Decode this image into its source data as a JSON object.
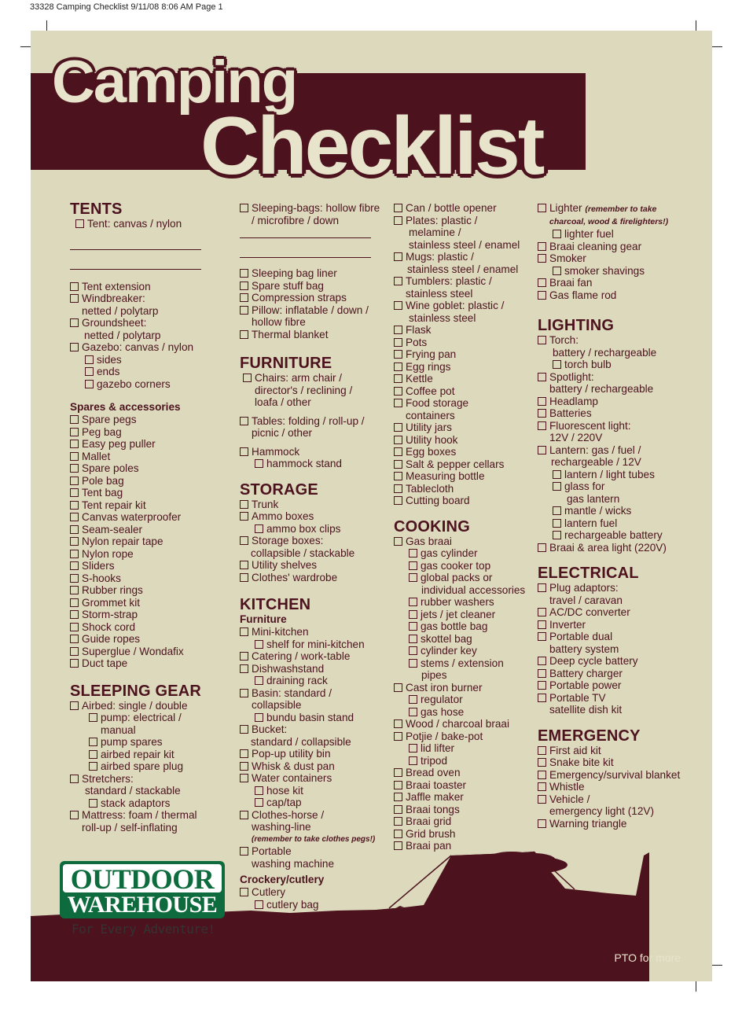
{
  "slug": "33328 Camping Checklist 9/11/08 8:06 AM Page 1",
  "title": {
    "line1": "Camping",
    "line2": "Checklist"
  },
  "colors": {
    "maroon": "#4c131e",
    "cream": "#ddd9bd",
    "green": "#0e6b3d"
  },
  "logo": {
    "top": "OUTDOOR",
    "bottom": "WAREHOUSE",
    "tagline": "For Every Adventure!"
  },
  "footer": {
    "pto": "PTO for more"
  },
  "col1": {
    "tents": {
      "heading": "TENTS",
      "first": "Tent: canvas / nylon",
      "items": [
        {
          "label": "Tent extension"
        },
        {
          "label": "Windbreaker:",
          "cont": "netted / polytarp"
        },
        {
          "label": "Groundsheet:",
          "cont": "netted / polytarp"
        },
        {
          "label": "Gazebo: canvas / nylon"
        }
      ],
      "gazebo_subs": [
        "sides",
        "ends",
        "gazebo corners"
      ]
    },
    "spares": {
      "heading": "Spares & accessories",
      "items": [
        "Spare pegs",
        "Peg bag",
        "Easy peg puller",
        "Mallet",
        "Spare poles",
        "Pole bag",
        "Tent bag",
        "Tent repair kit",
        "Canvas waterproofer",
        "Seam-sealer",
        "Nylon repair tape",
        "Nylon rope",
        "Sliders",
        "S-hooks",
        "Rubber rings",
        "Grommet kit",
        "Storm-strap",
        "Shock cord",
        "Guide ropes",
        "Superglue / Wondafix",
        "Duct tape"
      ]
    },
    "sleeping": {
      "heading": "SLEEPING GEAR",
      "airbed": "Airbed: single / double",
      "pump": "pump: electrical /",
      "pump_cont": "manual",
      "airbed_subs": [
        "pump spares",
        "airbed repair kit",
        "airbed spare plug"
      ],
      "stretchers": "Stretchers:",
      "stretchers_cont": "standard /  stackable",
      "stack": "stack adaptors",
      "mattress": "Mattress: foam / thermal",
      "mattress_cont": "roll-up / self-inflating"
    }
  },
  "col2": {
    "sleepingbags": "Sleeping-bags: hollow fibre",
    "sleepingbags_cont": "/ microfibre /  down",
    "bag_items": [
      "Sleeping bag liner",
      "Spare stuff bag",
      "Compression straps"
    ],
    "pillow": "Pillow: inflatable / down /",
    "pillow_cont": "hollow fibre",
    "thermal": "Thermal blanket",
    "furniture": {
      "heading": "FURNITURE",
      "chairs": "Chairs: arm chair /",
      "chairs_cont1": "director's / reclining /",
      "chairs_cont2": "loafa / other",
      "tables": "Tables: folding / roll-up /",
      "tables_cont": "picnic / other",
      "hammock": "Hammock",
      "hammock_stand": "hammock stand"
    },
    "storage": {
      "heading": "STORAGE",
      "trunk": "Trunk",
      "ammo": "Ammo boxes",
      "ammo_clips": "ammo box clips",
      "boxes": "Storage boxes:",
      "boxes_cont": "collapsible / stackable",
      "shelves": "Utility shelves",
      "wardrobe": "Clothes' wardrobe"
    },
    "kitchen": {
      "heading": "KITCHEN",
      "subheading": "Furniture",
      "mini": "Mini-kitchen",
      "mini_shelf": "shelf for mini-kitchen",
      "catering": "Catering / work-table",
      "dish": "Dishwashstand",
      "rack": "draining rack",
      "basin": "Basin: standard /",
      "basin_cont": "collapsible",
      "bundu": "bundu basin stand",
      "bucket": "Bucket:",
      "bucket_cont": "standard / collapsible",
      "bin": "Pop-up utility bin",
      "whisk": "Whisk & dust pan",
      "water": "Water containers",
      "hose": "hose kit",
      "cap": "cap/tap",
      "clothes": "Clothes-horse /",
      "clothes_cont": "washing-line",
      "clothes_note": "(remember to take clothes pegs!)",
      "washer": "Portable",
      "washer_cont": "washing machine",
      "crockery": "Crockery/cutlery",
      "cutlery": "Cutlery",
      "cutlery_bag": "cutlery bag"
    }
  },
  "col3": {
    "opener": "Can / bottle opener",
    "plates": "Plates: plastic /",
    "plates_cont1": "melamine /",
    "plates_cont2": "stainless steel / enamel",
    "mugs": "Mugs: plastic /",
    "mugs_cont": "stainless steel / enamel",
    "tumblers": "Tumblers: plastic /",
    "tumblers_cont": "stainless steel",
    "goblet": "Wine goblet: plastic /",
    "goblet_cont": "stainless steel",
    "items_a": [
      "Flask",
      "Pots",
      "Frying pan",
      "Egg rings",
      "Kettle",
      "Coffee pot"
    ],
    "food": "Food storage",
    "food_cont": "containers",
    "items_b": [
      "Utility jars",
      "Utility hook",
      "Egg boxes",
      "Salt & pepper cellars",
      "Measuring bottle",
      "Tablecloth",
      "Cutting board"
    ],
    "cooking": {
      "heading": "COOKING",
      "gas_braai": "Gas braai",
      "gas_subs_a": [
        "gas cylinder",
        "gas cooker top"
      ],
      "global": "global packs or",
      "global_cont": "individual accessories",
      "gas_subs_b": [
        "rubber washers",
        "jets / jet cleaner",
        "gas bottle bag",
        "skottel bag",
        "cylinder key"
      ],
      "stems": "stems / extension",
      "stems_cont": "pipes",
      "burner": "Cast iron burner",
      "burner_subs": [
        "regulator",
        "gas hose"
      ],
      "wood": "Wood / charcoal braai",
      "potjie": "Potjie / bake-pot",
      "potjie_subs": [
        "lid lifter",
        "tripod"
      ],
      "items": [
        "Bread oven",
        "Braai toaster",
        "Jaffle maker",
        "Braai tongs",
        "Braai grid",
        "Grid brush",
        "Braai pan"
      ]
    }
  },
  "col4": {
    "lighter": "Lighter",
    "lighter_note1": "(remember to take",
    "lighter_note2": "charcoal, wood & firelighters!)",
    "lighter_fuel": "lighter fuel",
    "cleaning": "Braai cleaning gear",
    "smoker": "Smoker",
    "shavings": "smoker shavings",
    "fan": "Braai fan",
    "rod": "Gas flame rod",
    "lighting": {
      "heading": "LIGHTING",
      "torch": "Torch:",
      "torch_cont": "battery / rechargeable",
      "bulb": "torch bulb",
      "spot": "Spotlight:",
      "spot_cont": "battery / rechargeable",
      "headlamp": "Headlamp",
      "batteries": "Batteries",
      "fluor": "Fluorescent light:",
      "fluor_cont": "12V / 220V",
      "lantern": "Lantern: gas / fuel /",
      "lantern_cont": "rechargeable / 12V",
      "tubes": "lantern / light tubes",
      "glass": "glass for",
      "glass_cont": "gas lantern",
      "mantle": "mantle / wicks",
      "lfuel": "lantern fuel",
      "rbattery": "rechargeable battery",
      "area": "Braai & area light (220V)"
    },
    "electrical": {
      "heading": "ELECTRICAL",
      "plug": "Plug adaptors:",
      "plug_cont": "travel / caravan",
      "acdc": "AC/DC converter",
      "inverter": "Inverter",
      "dual": "Portable dual",
      "dual_cont": "battery system",
      "deep": "Deep cycle battery",
      "charger": "Battery charger",
      "power": "Portable power",
      "tv": "Portable TV",
      "tv_cont": "satellite dish kit"
    },
    "emergency": {
      "heading": "EMERGENCY",
      "items": [
        "First aid kit",
        "Snake bite kit",
        "Emergency/survival blanket",
        "Whistle"
      ],
      "vehicle": "Vehicle /",
      "vehicle_cont": "emergency light (12V)",
      "triangle": "Warning triangle"
    }
  }
}
